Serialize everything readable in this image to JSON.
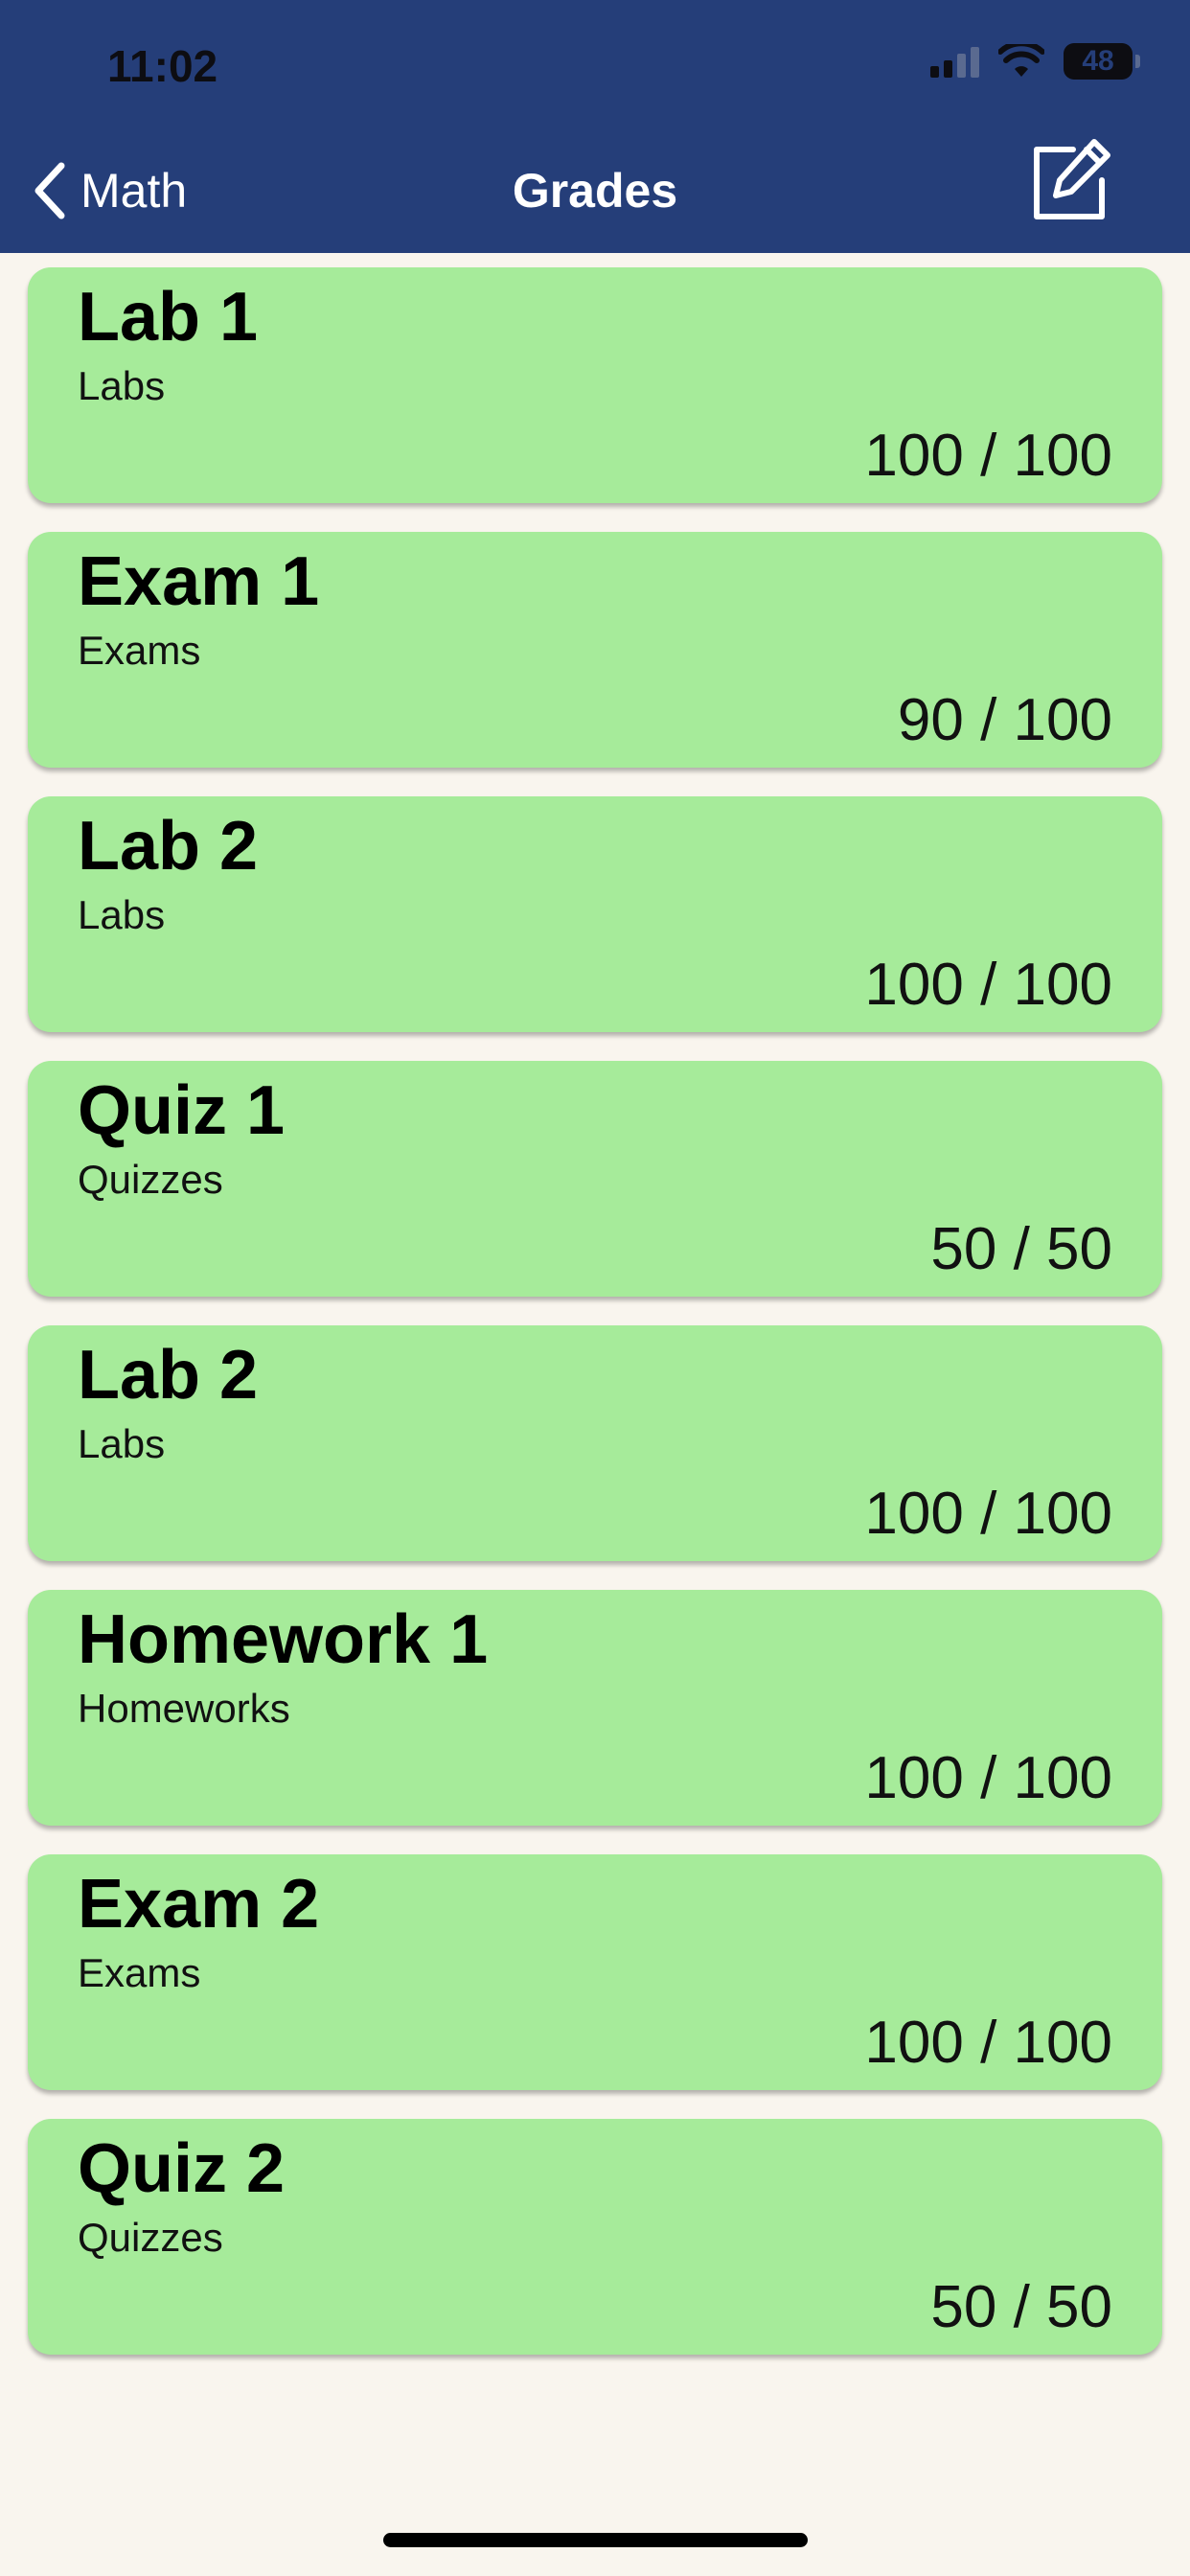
{
  "status_bar": {
    "time": "11:02",
    "battery": "48"
  },
  "nav": {
    "back_label": "Math",
    "title": "Grades"
  },
  "grades": [
    {
      "title": "Lab 1",
      "category": "Labs",
      "score": "100 / 100"
    },
    {
      "title": "Exam 1",
      "category": "Exams",
      "score": "90 / 100"
    },
    {
      "title": "Lab 2",
      "category": "Labs",
      "score": "100 / 100"
    },
    {
      "title": "Quiz 1",
      "category": "Quizzes",
      "score": "50 / 50"
    },
    {
      "title": "Lab 2",
      "category": "Labs",
      "score": "100 / 100"
    },
    {
      "title": "Homework 1",
      "category": "Homeworks",
      "score": "100 / 100"
    },
    {
      "title": "Exam 2",
      "category": "Exams",
      "score": "100 / 100"
    },
    {
      "title": "Quiz 2",
      "category": "Quizzes",
      "score": "50 / 50"
    }
  ],
  "icons": {
    "back": "chevron-left-icon",
    "edit": "edit-square-icon",
    "signal": "signal-icon",
    "wifi": "wifi-icon",
    "battery": "battery-icon"
  },
  "colors": {
    "header": "#253e79",
    "card": "#a6eb9a",
    "background": "#f9f5ee"
  }
}
